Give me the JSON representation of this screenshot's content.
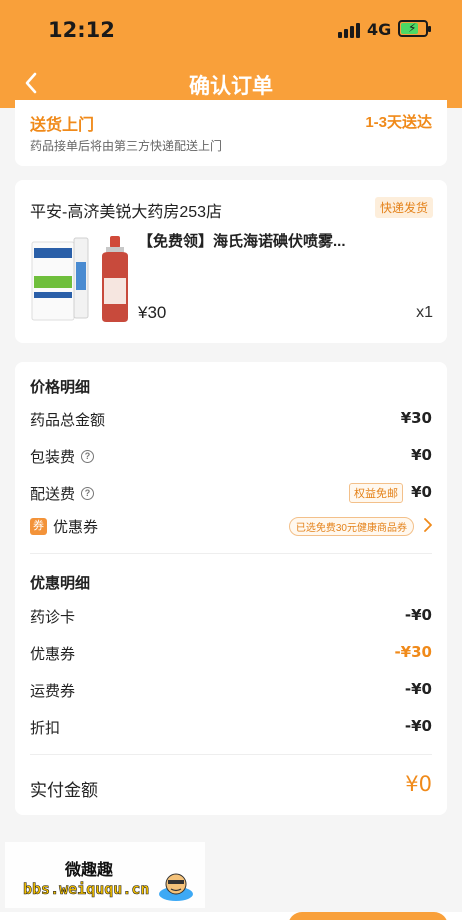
{
  "status_bar": {
    "time": "12:12",
    "network": "4G",
    "battery_fraction": 0.7
  },
  "nav": {
    "title": "确认订单"
  },
  "delivery": {
    "title": "送货上门",
    "eta": "1-3天送达",
    "desc": "药品接单后将由第三方快递配送上门"
  },
  "store": {
    "name": "平安-高济美锐大药房253店",
    "ship_badge": "快递发货",
    "product": {
      "name": "【免费领】海氏海诺碘伏喷雾...",
      "price": "¥30",
      "qty": "x1"
    }
  },
  "price_detail": {
    "title": "价格明细",
    "rows": [
      {
        "label": "药品总金额",
        "value": "¥30"
      },
      {
        "label": "包装费",
        "value": "¥0"
      },
      {
        "label": "配送费",
        "tag": "权益免邮",
        "value": "¥0"
      },
      {
        "label": "优惠券",
        "icon_text": "券",
        "chip": "已选免费30元健康商品券"
      }
    ]
  },
  "discount_detail": {
    "title": "优惠明细",
    "rows": [
      {
        "label": "药诊卡",
        "value": "-¥0"
      },
      {
        "label": "优惠券",
        "value": "-¥30"
      },
      {
        "label": "运费券",
        "value": "-¥0"
      },
      {
        "label": "折扣",
        "value": "-¥0"
      }
    ]
  },
  "total": {
    "label": "实付金额",
    "value": "¥0"
  },
  "watermark": {
    "text_cn": "微趣趣",
    "url": "bbs.weiququ.cn"
  },
  "colors": {
    "brand": "#f9a03a",
    "accent": "#f08a1a"
  }
}
